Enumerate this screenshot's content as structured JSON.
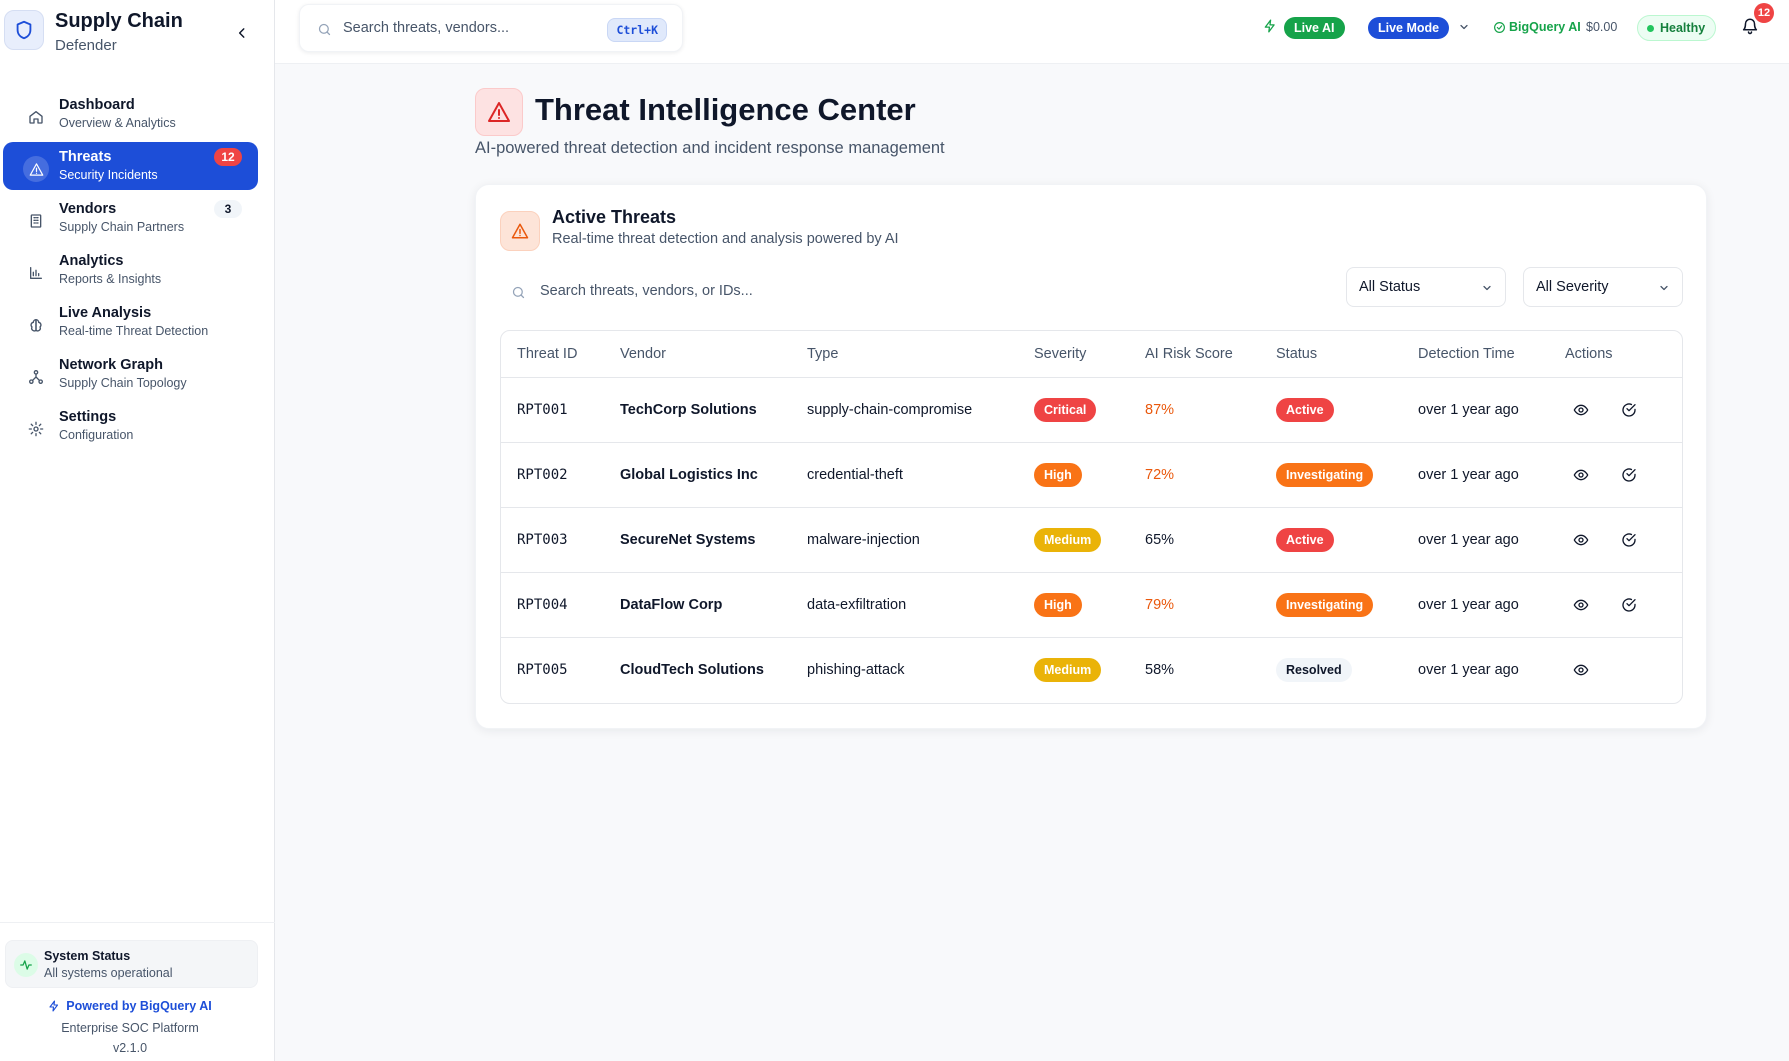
{
  "sidebar": {
    "brand_title": "Supply Chain",
    "brand_sub": "Defender",
    "items": [
      {
        "label": "Dashboard",
        "desc": "Overview & Analytics",
        "icon": "home-icon",
        "badge": ""
      },
      {
        "label": "Threats",
        "desc": "Security Incidents",
        "icon": "alert-triangle-icon",
        "badge": "12"
      },
      {
        "label": "Vendors",
        "desc": "Supply Chain Partners",
        "icon": "building-icon",
        "badge": "3"
      },
      {
        "label": "Analytics",
        "desc": "Reports & Insights",
        "icon": "bar-chart-icon",
        "badge": ""
      },
      {
        "label": "Live Analysis",
        "desc": "Real-time Threat Detection",
        "icon": "brain-icon",
        "badge": ""
      },
      {
        "label": "Network Graph",
        "desc": "Supply Chain Topology",
        "icon": "network-icon",
        "badge": ""
      },
      {
        "label": "Settings",
        "desc": "Configuration",
        "icon": "gear-icon",
        "badge": ""
      }
    ],
    "system_status": {
      "title": "System Status",
      "desc": "All systems operational"
    },
    "powered_by": "Powered by BigQuery AI",
    "platform": "Enterprise SOC Platform",
    "version": "v2.1.0"
  },
  "topbar": {
    "search_placeholder": "Search threats, vendors...",
    "shortcut": "Ctrl+K",
    "live_ai": "Live AI",
    "live_mode": "Live Mode",
    "bigquery_label": "BigQuery AI",
    "bigquery_cost": "$0.00",
    "health": "Healthy",
    "notifications": "12"
  },
  "page": {
    "title": "Threat Intelligence Center",
    "subtitle": "AI-powered threat detection and incident response management"
  },
  "card": {
    "title": "Active Threats",
    "subtitle": "Real-time threat detection and analysis powered by AI",
    "search_placeholder": "Search threats, vendors, or IDs...",
    "status_filter": "All Status",
    "severity_filter": "All Severity"
  },
  "table": {
    "headers": [
      "Threat ID",
      "Vendor",
      "Type",
      "Severity",
      "AI Risk Score",
      "Status",
      "Detection Time",
      "Actions"
    ],
    "rows": [
      {
        "id": "RPT001",
        "vendor": "TechCorp Solutions",
        "type": "supply-chain-compromise",
        "severity": "Critical",
        "score": "87%",
        "status": "Active",
        "time": "over 1 year ago"
      },
      {
        "id": "RPT002",
        "vendor": "Global Logistics Inc",
        "type": "credential-theft",
        "severity": "High",
        "score": "72%",
        "status": "Investigating",
        "time": "over 1 year ago"
      },
      {
        "id": "RPT003",
        "vendor": "SecureNet Systems",
        "type": "malware-injection",
        "severity": "Medium",
        "score": "65%",
        "status": "Active",
        "time": "over 1 year ago"
      },
      {
        "id": "RPT004",
        "vendor": "DataFlow Corp",
        "type": "data-exfiltration",
        "severity": "High",
        "score": "79%",
        "status": "Investigating",
        "time": "over 1 year ago"
      },
      {
        "id": "RPT005",
        "vendor": "CloudTech Solutions",
        "type": "phishing-attack",
        "severity": "Medium",
        "score": "58%",
        "status": "Resolved",
        "time": "over 1 year ago"
      }
    ]
  },
  "colors": {
    "accent": "#1d4ed8",
    "critical": "#ef4444",
    "high": "#f97316",
    "medium": "#eab308",
    "active": "#ef4444",
    "investigating": "#f97316",
    "resolved": "#f1f5f9",
    "score_high": "#ea580c",
    "healthy": "#16a34a"
  }
}
